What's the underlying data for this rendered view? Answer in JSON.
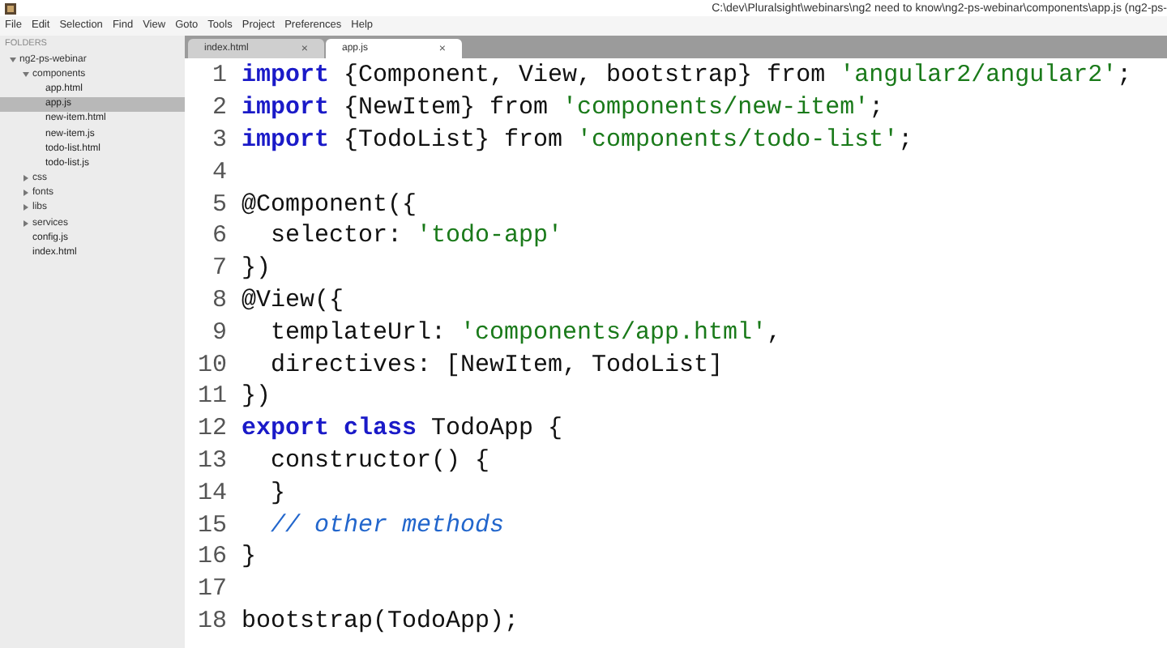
{
  "window": {
    "title": "C:\\dev\\Pluralsight\\webinars\\ng2 need to know\\ng2-ps-webinar\\components\\app.js (ng2-ps-"
  },
  "menu": [
    "File",
    "Edit",
    "Selection",
    "Find",
    "View",
    "Goto",
    "Tools",
    "Project",
    "Preferences",
    "Help"
  ],
  "sidebar": {
    "heading": "FOLDERS",
    "tree": [
      {
        "label": "ng2-ps-webinar",
        "kind": "folder",
        "expanded": true,
        "selected": false,
        "children": [
          {
            "label": "components",
            "kind": "folder",
            "expanded": true,
            "selected": false,
            "children": [
              {
                "label": "app.html",
                "kind": "file",
                "selected": false
              },
              {
                "label": "app.js",
                "kind": "file",
                "selected": true
              },
              {
                "label": "new-item.html",
                "kind": "file",
                "selected": false
              },
              {
                "label": "new-item.js",
                "kind": "file",
                "selected": false
              },
              {
                "label": "todo-list.html",
                "kind": "file",
                "selected": false
              },
              {
                "label": "todo-list.js",
                "kind": "file",
                "selected": false
              }
            ]
          },
          {
            "label": "css",
            "kind": "folder",
            "expanded": false,
            "selected": false
          },
          {
            "label": "fonts",
            "kind": "folder",
            "expanded": false,
            "selected": false
          },
          {
            "label": "libs",
            "kind": "folder",
            "expanded": false,
            "selected": false
          },
          {
            "label": "services",
            "kind": "folder",
            "expanded": false,
            "selected": false
          },
          {
            "label": "config.js",
            "kind": "file",
            "selected": false
          },
          {
            "label": "index.html",
            "kind": "file",
            "selected": false
          }
        ]
      }
    ]
  },
  "tabs": [
    {
      "label": "index.html",
      "close": "×",
      "selected": false
    },
    {
      "label": "app.js",
      "close": "×",
      "selected": true
    }
  ],
  "editor": {
    "lines": [
      {
        "number": "1",
        "tokens": [
          {
            "kind": "keyword",
            "text": "import"
          },
          {
            "kind": "plain",
            "text": " {Component, View, bootstrap} from "
          },
          {
            "kind": "string",
            "text": "'angular2/angular2'"
          },
          {
            "kind": "plain",
            "text": ";"
          }
        ]
      },
      {
        "number": "2",
        "tokens": [
          {
            "kind": "keyword",
            "text": "import"
          },
          {
            "kind": "plain",
            "text": " {NewItem} from "
          },
          {
            "kind": "string",
            "text": "'components/new-item'"
          },
          {
            "kind": "plain",
            "text": ";"
          }
        ]
      },
      {
        "number": "3",
        "tokens": [
          {
            "kind": "keyword",
            "text": "import"
          },
          {
            "kind": "plain",
            "text": " {TodoList} from "
          },
          {
            "kind": "string",
            "text": "'components/todo-list'"
          },
          {
            "kind": "plain",
            "text": ";"
          }
        ]
      },
      {
        "number": "4"
      },
      {
        "number": "5",
        "tokens": [
          {
            "kind": "plain",
            "text": "@Component({"
          }
        ]
      },
      {
        "number": "6",
        "tokens": [
          {
            "kind": "plain",
            "text": "  selector: "
          },
          {
            "kind": "string",
            "text": "'todo-app'"
          }
        ]
      },
      {
        "number": "7",
        "tokens": [
          {
            "kind": "plain",
            "text": "})"
          }
        ]
      },
      {
        "number": "8",
        "tokens": [
          {
            "kind": "plain",
            "text": "@View({"
          }
        ]
      },
      {
        "number": "9",
        "tokens": [
          {
            "kind": "plain",
            "text": "  templateUrl: "
          },
          {
            "kind": "string",
            "text": "'components/app.html'"
          },
          {
            "kind": "plain",
            "text": ","
          }
        ]
      },
      {
        "number": "10",
        "tokens": [
          {
            "kind": "plain",
            "text": "  directives: [NewItem, TodoList]"
          }
        ]
      },
      {
        "number": "11",
        "tokens": [
          {
            "kind": "plain",
            "text": "})"
          }
        ]
      },
      {
        "number": "12",
        "tokens": [
          {
            "kind": "keyword",
            "text": "export class"
          },
          {
            "kind": "plain",
            "text": " TodoApp {"
          }
        ]
      },
      {
        "number": "13",
        "tokens": [
          {
            "kind": "plain",
            "text": "  constructor() {"
          }
        ]
      },
      {
        "number": "14",
        "tokens": [
          {
            "kind": "plain",
            "text": "  }"
          }
        ]
      },
      {
        "number": "15",
        "tokens": [
          {
            "kind": "comment",
            "text": "  // other methods"
          }
        ]
      },
      {
        "number": "16",
        "tokens": [
          {
            "kind": "plain",
            "text": "}"
          }
        ]
      },
      {
        "number": "17"
      },
      {
        "number": "18",
        "tokens": [
          {
            "kind": "plain",
            "text": "bootstrap(TodoApp);"
          }
        ]
      }
    ]
  }
}
